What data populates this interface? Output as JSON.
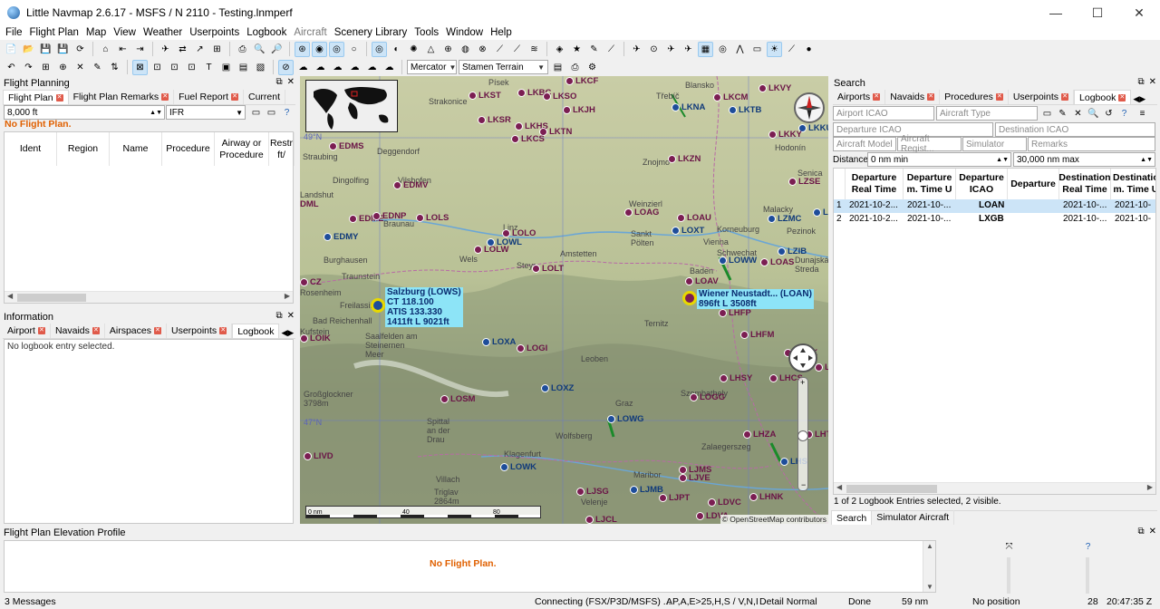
{
  "window": {
    "title": "Little Navmap 2.6.17 - MSFS / N 2110 - Testing.lnmperf",
    "minimize": "—",
    "maximize": "☐",
    "close": "✕"
  },
  "menu": [
    "File",
    "Flight Plan",
    "Map",
    "View",
    "Weather",
    "Userpoints",
    "Logbook",
    "Aircraft",
    "Scenery Library",
    "Tools",
    "Window",
    "Help"
  ],
  "toolbar": {
    "projection": "Mercator",
    "theme": "Stamen Terrain"
  },
  "flight_planning": {
    "title": "Flight Planning",
    "tabs": [
      "Flight Plan",
      "Flight Plan Remarks",
      "Fuel Report",
      "Current"
    ],
    "altitude": "8,000 ft",
    "rules": "IFR",
    "no_plan": "No Flight Plan.",
    "columns": [
      "Ident",
      "Region",
      "Name",
      "Procedure",
      "Airway or Procedure",
      "Restr ft/"
    ]
  },
  "information": {
    "title": "Information",
    "tabs": [
      "Airport",
      "Navaids",
      "Airspaces",
      "Userpoints",
      "Logbook"
    ],
    "message": "No logbook entry selected."
  },
  "map": {
    "labels": [
      {
        "text": "Písek",
        "cls": "lbl"
      },
      {
        "text": "Strakonice",
        "cls": "lbl"
      },
      {
        "text": "Blansko",
        "cls": "lbl"
      },
      {
        "text": "Třebíč",
        "cls": "lbl"
      },
      {
        "text": "Znojmo",
        "cls": "lbl"
      },
      {
        "text": "Hodonín",
        "cls": "lbl"
      },
      {
        "text": "Senica",
        "cls": "lbl"
      },
      {
        "text": "Malacky",
        "cls": "lbl"
      },
      {
        "text": "Pezinok",
        "cls": "lbl"
      },
      {
        "text": "Deggendorf",
        "cls": "lbl"
      },
      {
        "text": "Straubing",
        "cls": "lbl"
      },
      {
        "text": "Dingolfing",
        "cls": "lbl"
      },
      {
        "text": "Vilshofen",
        "cls": "lbl"
      },
      {
        "text": "Landshut",
        "cls": "lbl"
      },
      {
        "text": "Braunau",
        "cls": "lbl"
      },
      {
        "text": "Burghausen",
        "cls": "lbl"
      },
      {
        "text": "Traunstein",
        "cls": "lbl"
      },
      {
        "text": "Rosenheim",
        "cls": "lbl"
      },
      {
        "text": "Freilassing",
        "cls": "lbl"
      },
      {
        "text": "Bad Reichenhall",
        "cls": "lbl"
      },
      {
        "text": "Kufstein",
        "cls": "lbl"
      },
      {
        "text": "Saalfelden am Steinernen Meer",
        "cls": "lbl"
      },
      {
        "text": "Großglockner 3798m",
        "cls": "lbl"
      },
      {
        "text": "Spittal an der Drau",
        "cls": "lbl"
      },
      {
        "text": "Villach",
        "cls": "lbl"
      },
      {
        "text": "Triglav 2864m",
        "cls": "lbl"
      },
      {
        "text": "Klagenfurt",
        "cls": "lbl"
      },
      {
        "text": "Wolfsberg",
        "cls": "lbl"
      },
      {
        "text": "Leoben",
        "cls": "lbl"
      },
      {
        "text": "Graz",
        "cls": "lbl"
      },
      {
        "text": "Maribor",
        "cls": "lbl"
      },
      {
        "text": "Velenje",
        "cls": "lbl"
      },
      {
        "text": "Szombathely",
        "cls": "lbl"
      },
      {
        "text": "Zalaegerszeg",
        "cls": "lbl"
      },
      {
        "text": "Ternitz",
        "cls": "lbl"
      },
      {
        "text": "Baden",
        "cls": "lbl"
      },
      {
        "text": "Vienna",
        "cls": "lbl"
      },
      {
        "text": "Schwechat",
        "cls": "lbl"
      },
      {
        "text": "Sankt Pölten",
        "cls": "lbl"
      },
      {
        "text": "Amstetten",
        "cls": "lbl"
      },
      {
        "text": "Steyr",
        "cls": "lbl"
      },
      {
        "text": "Linz",
        "cls": "lbl"
      },
      {
        "text": "Wels",
        "cls": "lbl"
      },
      {
        "text": "Weinzierl",
        "cls": "lbl"
      },
      {
        "text": "Korneuburg",
        "cls": "lbl"
      },
      {
        "text": "Dunajská Streda",
        "cls": "lbl"
      },
      {
        "text": "49°N",
        "cls": "lbl"
      },
      {
        "text": "47°N",
        "cls": "lbl"
      }
    ],
    "airports": [
      {
        "id": "LKST"
      },
      {
        "id": "LKBC"
      },
      {
        "id": "LKSO"
      },
      {
        "id": "LKCF"
      },
      {
        "id": "LKJH"
      },
      {
        "id": "LKSR"
      },
      {
        "id": "LKHS"
      },
      {
        "id": "LKTN"
      },
      {
        "id": "LKCS"
      },
      {
        "id": "LKNA"
      },
      {
        "id": "LKTB"
      },
      {
        "id": "LKCM"
      },
      {
        "id": "LKVY"
      },
      {
        "id": "LKKU"
      },
      {
        "id": "LKZN"
      },
      {
        "id": "LKKY"
      },
      {
        "id": "LZSE"
      },
      {
        "id": "EDMS"
      },
      {
        "id": "EDMV"
      },
      {
        "id": "EDME"
      },
      {
        "id": "EDNP"
      },
      {
        "id": "EDMY"
      },
      {
        "id": "LOLS"
      },
      {
        "id": "LOLO"
      },
      {
        "id": "LOWL"
      },
      {
        "id": "LOLW"
      },
      {
        "id": "LOLT"
      },
      {
        "id": "LOAG"
      },
      {
        "id": "LOAU"
      },
      {
        "id": "LOXT"
      },
      {
        "id": "LOWW"
      },
      {
        "id": "LOAS"
      },
      {
        "id": "LZIB"
      },
      {
        "id": "LZMC"
      },
      {
        "id": "LOAV"
      },
      {
        "id": "LHFP"
      },
      {
        "id": "LHFM"
      },
      {
        "id": "LOXA"
      },
      {
        "id": "LOGI"
      },
      {
        "id": "LOXZ"
      },
      {
        "id": "LOSM"
      },
      {
        "id": "LOWG"
      },
      {
        "id": "LHSY"
      },
      {
        "id": "LHCS"
      },
      {
        "id": "LOGG"
      },
      {
        "id": "LHZA"
      },
      {
        "id": "LIVD"
      },
      {
        "id": "LOWK"
      },
      {
        "id": "LJMS"
      },
      {
        "id": "LJVE"
      },
      {
        "id": "LJMB"
      },
      {
        "id": "LJPT"
      },
      {
        "id": "LJSG"
      },
      {
        "id": "LDVC"
      },
      {
        "id": "LHNK"
      },
      {
        "id": "LDVA"
      },
      {
        "id": "LJCL"
      },
      {
        "id": "LOIK"
      },
      {
        "id": "LHKK"
      },
      {
        "id": "LHTP"
      },
      {
        "id": "LHS"
      },
      {
        "id": "LZ"
      },
      {
        "id": "LHB"
      },
      {
        "id": "CZ"
      },
      {
        "id": "DML"
      }
    ],
    "callouts": {
      "salzburg": "Salzburg (LOWS)\nCT 118.100\nATIS 133.330\n1411ft L 9021ft",
      "wiener": "Wiener Neustadt... (LOAN)\n896ft L 3508ft"
    },
    "attribution": "© OpenStreetMap contributors",
    "scale": [
      "0 nm",
      "40",
      "80"
    ]
  },
  "search": {
    "title": "Search",
    "tabs": [
      "Airports",
      "Navaids",
      "Procedures",
      "Userpoints",
      "Logbook"
    ],
    "placeholders": {
      "airport_icao": "Airport ICAO",
      "aircraft_type": "Aircraft Type",
      "departure_icao": "Departure ICAO",
      "destination_icao": "Destination ICAO",
      "aircraft_model": "Aircraft Model",
      "aircraft_registration": "Aircraft Regist...",
      "simulator": "Simulator",
      "remarks": "Remarks"
    },
    "distance_label": "Distance:",
    "distance_min": "0 nm min",
    "distance_max": "30,000 nm max",
    "columns": [
      "Departure Real Time",
      "Departure m. Time U",
      "Departure ICAO",
      "Departure",
      "Destination Real Time",
      "Destinatio m. Time U"
    ],
    "rows": [
      {
        "num": "1",
        "dep_real": "2021-10-2...",
        "dep_sim": "2021-10-...",
        "icao": "LOAN",
        "departure": "",
        "dest_real": "2021-10-...",
        "dest_sim": "2021-10-"
      },
      {
        "num": "2",
        "dep_real": "2021-10-2...",
        "dep_sim": "2021-10-...",
        "icao": "LXGB",
        "departure": "",
        "dest_real": "2021-10-...",
        "dest_sim": "2021-10-"
      }
    ],
    "status": "1 of 2 Logbook Entries selected, 2 visible.",
    "bottom_tabs": [
      "Search",
      "Simulator Aircraft"
    ]
  },
  "profile": {
    "title": "Flight Plan Elevation Profile",
    "no_plan": "No Flight Plan."
  },
  "statusbar": {
    "messages": "3 Messages",
    "connection": "Connecting (FSX/P3D/MSFS) ...",
    "filter": "AP,A,E>25,H,S / V,N,I",
    "detail": "Detail Normal",
    "state": "Done",
    "distance": "59 nm",
    "position": "No position",
    "count": "28",
    "time": "20:47:35 Z"
  },
  "colors": {
    "airport_civil": "#7b1e52",
    "airport_military": "#1e4d9a",
    "callout_bg": "#8de4f7",
    "warning_text": "#e06000"
  }
}
